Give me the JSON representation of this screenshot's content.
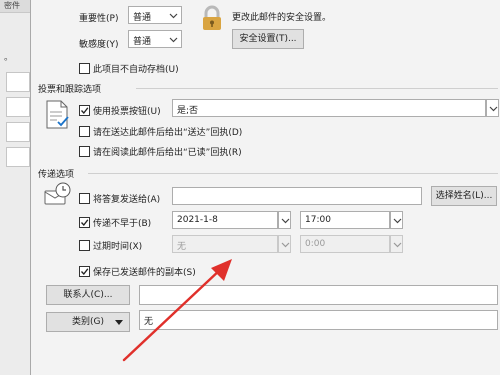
{
  "background": {
    "tab_label": "密件",
    "dot_text": "。"
  },
  "properties": {
    "importance_label": "重要性(P)",
    "importance_value": "普通",
    "sensitivity_label": "敏感度(Y)",
    "sensitivity_value": "普通",
    "security_text": "更改此邮件的安全设置。",
    "security_button": "安全设置(T)...",
    "no_autoarchive_label": "此项目不自动存档(U)"
  },
  "voting": {
    "section_title": "投票和跟踪选项",
    "use_voting_label": "使用投票按钮(U)",
    "voting_value": "是;否",
    "delivery_receipt_label": "请在送达此邮件后给出“送达”回执(D)",
    "read_receipt_label": "请在阅读此邮件后给出“已读”回执(R)"
  },
  "delivery": {
    "section_title": "传递选项",
    "reply_to_label": "将答复发送给(A)",
    "reply_to_value": "",
    "select_names_button": "选择姓名(L)...",
    "do_not_deliver_label": "传递不早于(B)",
    "deliver_date": "2021-1-8",
    "deliver_time": "17:00",
    "expires_label": "过期时间(X)",
    "expires_date": "无",
    "expires_time": "0:00",
    "save_copy_label": "保存已发送邮件的副本(S)"
  },
  "contacts": {
    "button": "联系人(C)...",
    "value": ""
  },
  "categories": {
    "button": "类别(G)",
    "value": "无"
  },
  "state": {
    "no_autoarchive_checked": false,
    "use_voting_checked": true,
    "delivery_receipt_checked": false,
    "read_receipt_checked": false,
    "reply_to_checked": false,
    "do_not_deliver_checked": true,
    "expires_checked": false,
    "save_copy_checked": true
  },
  "colors": {
    "annotation_arrow": "#e0302b",
    "lock_icon": "#d9a441"
  }
}
